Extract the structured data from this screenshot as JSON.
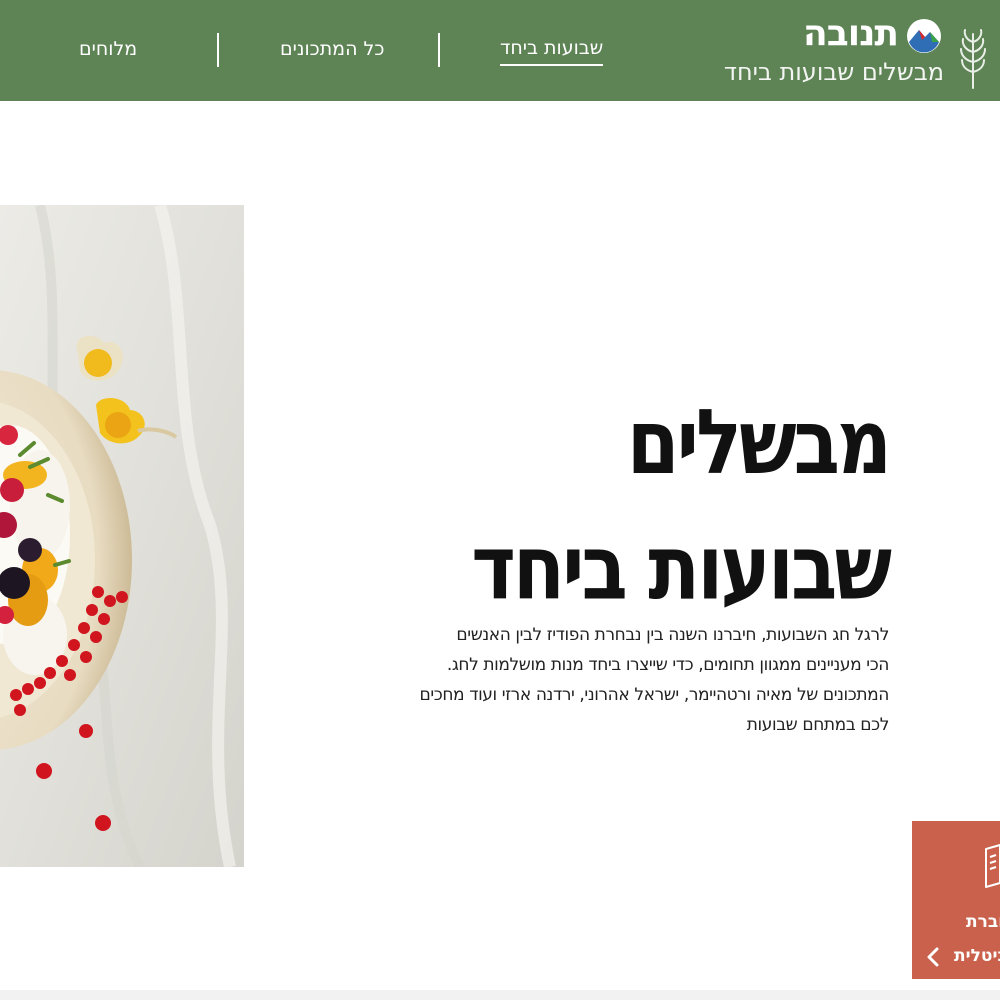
{
  "header": {
    "brand": "תנובה",
    "tagline": "מבשלים שבועות ביחד",
    "nav": [
      {
        "label": "שבועות ביחד",
        "active": true
      },
      {
        "label": "כל המתכונים",
        "active": false
      },
      {
        "label": "מלוחים",
        "active": false
      }
    ],
    "colors": {
      "background": "#5e8456"
    }
  },
  "hero": {
    "title_line1": "מבשלים",
    "title_line2": "שבועות ביחד",
    "text_lines": [
      "לרגל חג השבועות, חיברנו השנה בין נבחרת הפודיז לבין האנשים",
      "הכי מעניינים ממגוון תחומים, כדי שייצרו ביחד מנות מושלמות לחג.",
      "המתכונים של מאיה ורטהיימר, ישראל אהרוני, ירדנה ארזי ועוד מחכים",
      "לכם במתחם שבועות"
    ],
    "image_icon": "pavlova-berries-image"
  },
  "booklet": {
    "line1": "וברת",
    "line2": "יגיטלית",
    "icon": "booklet-icon",
    "color": "#c9614d"
  }
}
